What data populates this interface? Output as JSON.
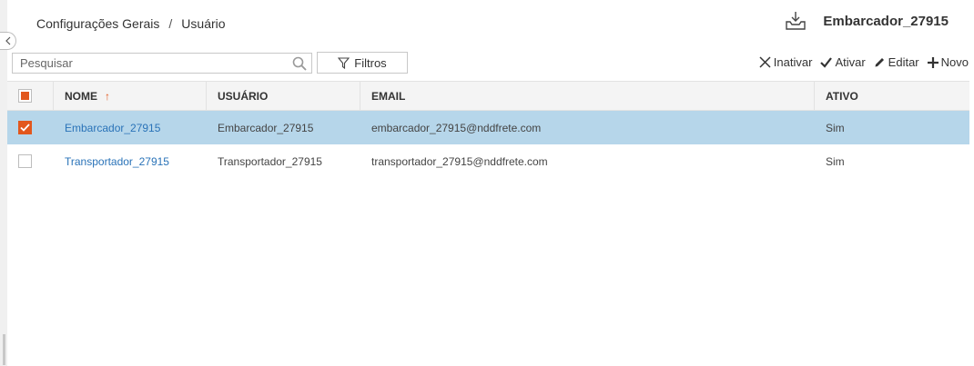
{
  "breadcrumb": {
    "parent": "Configurações Gerais",
    "separator": "/",
    "current": "Usuário"
  },
  "account": {
    "name": "Embarcador_27915"
  },
  "search": {
    "placeholder": "Pesquisar",
    "value": ""
  },
  "toolbar": {
    "filter_label": "Filtros",
    "inactivate_label": "Inativar",
    "activate_label": "Ativar",
    "edit_label": "Editar",
    "new_label": "Novo"
  },
  "table": {
    "columns": {
      "nome": "NOME",
      "usuario": "USUÁRIO",
      "email": "EMAIL",
      "ativo": "ATIVO"
    },
    "sort_indicator": "↑",
    "rows": [
      {
        "nome": "Embarcador_27915",
        "usuario": "Embarcador_27915",
        "email": "embarcador_27915@nddfrete.com",
        "ativo": "Sim",
        "selected": true
      },
      {
        "nome": "Transportador_27915",
        "usuario": "Transportador_27915",
        "email": "transportador_27915@nddfrete.com",
        "ativo": "Sim",
        "selected": false
      }
    ]
  },
  "colors": {
    "accent": "#e2571d",
    "selected_row": "#b6d6ea",
    "link": "#2a73b8"
  },
  "icons": [
    "chevron-left-icon",
    "download-tray-icon",
    "search-icon",
    "filter-icon",
    "close-icon",
    "check-icon",
    "pencil-icon",
    "plus-icon"
  ]
}
